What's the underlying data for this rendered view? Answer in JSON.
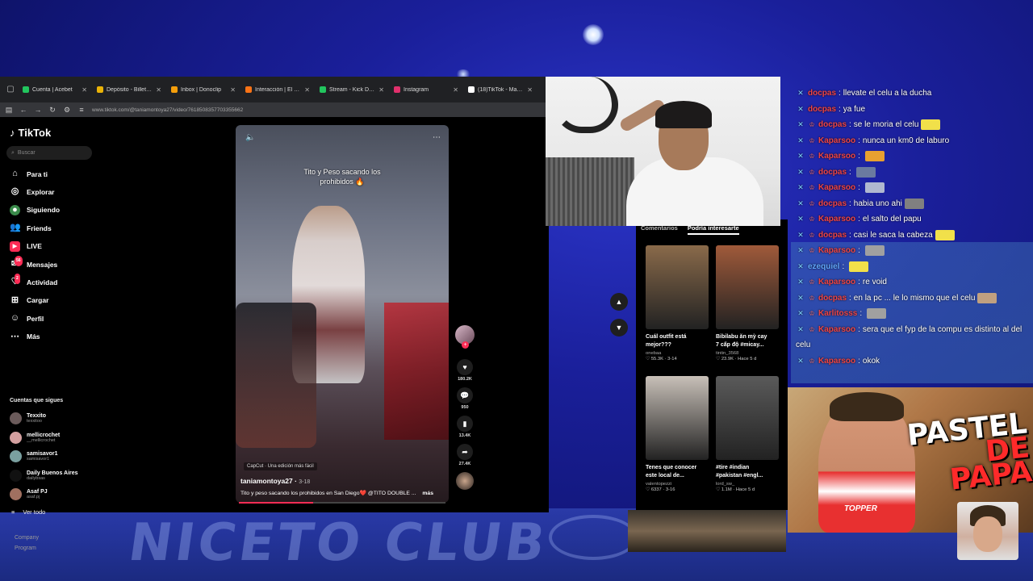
{
  "browser": {
    "tabs": [
      {
        "title": "Cuenta | Acebet",
        "color": "#22c55e"
      },
      {
        "title": "Depósito - Billeteras -",
        "color": "#eab308"
      },
      {
        "title": "Inbox | Donoclip",
        "color": "#f59e0b"
      },
      {
        "title": "Interacción | El mejor s",
        "color": "#f97316"
      },
      {
        "title": "Stream - Kick Dash",
        "color": "#22c55e"
      },
      {
        "title": "Instagram",
        "color": "#e1306c"
      },
      {
        "title": "(18)TikTok - Make You",
        "color": "#ffffff"
      }
    ],
    "url": "www.tiktok.com/@taniamontoya27/video/7618508357703355662"
  },
  "tiktok": {
    "logo": "TikTok",
    "search_placeholder": "Buscar",
    "nav": [
      {
        "label": "Para ti",
        "icon": "home-icon"
      },
      {
        "label": "Explorar",
        "icon": "compass-icon"
      },
      {
        "label": "Siguiendo",
        "icon": "following-icon"
      },
      {
        "label": "Friends",
        "icon": "friends-icon"
      },
      {
        "label": "LIVE",
        "icon": "live-icon"
      },
      {
        "label": "Mensajes",
        "icon": "messages-icon",
        "badge": "56"
      },
      {
        "label": "Actividad",
        "icon": "activity-icon",
        "badge": "2"
      },
      {
        "label": "Cargar",
        "icon": "upload-icon"
      },
      {
        "label": "Perfil",
        "icon": "profile-icon"
      },
      {
        "label": "Más",
        "icon": "more-icon"
      }
    ],
    "following_header": "Cuentas que sigues",
    "accounts": [
      {
        "name": "Texxito",
        "handle": "texxitoo",
        "color": "#6b5b5b"
      },
      {
        "name": "mellicrochet",
        "handle": "__mellicrochet",
        "color": "#d4a0a0"
      },
      {
        "name": "samisavor1",
        "handle": "samisavor1",
        "color": "#7aa0a0"
      },
      {
        "name": "Daily Buenos Aires",
        "handle": "dailybsas",
        "color": "#111111"
      },
      {
        "name": "Asaf PJ",
        "handle": "asaf.pj",
        "color": "#a07060"
      }
    ],
    "see_all": "Ver todo",
    "footer": [
      "Company",
      "Program"
    ]
  },
  "video": {
    "caption_line1": "Tito y Peso sacando los",
    "caption_line2": "prohibidos 🔥",
    "capcut": "CapCut · Una edición más fácil",
    "author": "taniamontoya27",
    "date": "3-18",
    "description": "Tito y peso sacando los prohibidos en San Diego❤️ @TITO DOUBLE ...",
    "more": "más",
    "progress": 0.36,
    "likes": "180.2K",
    "comments": "950",
    "saves": "13.4K",
    "shares": "27.4K"
  },
  "side_panel": {
    "tab_comments": "Comentarios",
    "tab_interesting": "Podría interesarte",
    "cards": [
      {
        "title1": "Cuál outfit está",
        "title2": "mejor???",
        "user": "onebaa",
        "meta": "55.3K · 3-14",
        "thumb": "#8a6a4a"
      },
      {
        "title1": "Bibilabu ăn mỳ cay",
        "title2": "7 cấp độ #micay...",
        "user": "tintin_3568",
        "meta": "23.9K · Hace 5 d",
        "thumb": "#a05a3a"
      },
      {
        "title1": "Tenes que conocer",
        "title2": "este local de...",
        "user": "valentopezzi",
        "meta": "6337 · 3-16",
        "thumb": "#c8c0b8"
      },
      {
        "title1": "#tire #indian",
        "title2": "#pakistan #engl...",
        "user": "lord_sw_",
        "meta": "1.1M · Hace 5 d",
        "thumb": "#5a5a5a"
      }
    ]
  },
  "chat": [
    {
      "user": "docpas",
      "text": "llevate el celu a la ducha",
      "ucolor": "#ef4444",
      "badge": "",
      "emote": ""
    },
    {
      "user": "docpas",
      "text": "ya fue",
      "ucolor": "#ef4444",
      "badge": "",
      "emote": ""
    },
    {
      "user": "docpas",
      "text": "se le moria el celu",
      "ucolor": "#ef4444",
      "badge": "sword",
      "emote": "#f1e04a"
    },
    {
      "user": "Kaparsoo",
      "text": "nunca un km0 de laburo",
      "ucolor": "#ef4444",
      "badge": "sword",
      "emote": ""
    },
    {
      "user": "Kaparsoo",
      "text": "",
      "ucolor": "#ef4444",
      "badge": "sword",
      "emote": "#e8a030"
    },
    {
      "user": "docpas",
      "text": "",
      "ucolor": "#ef4444",
      "badge": "sword",
      "emote": "#6a7aa0"
    },
    {
      "user": "Kaparsoo",
      "text": "",
      "ucolor": "#ef4444",
      "badge": "sword",
      "emote": "#b0b8d0"
    },
    {
      "user": "docpas",
      "text": "habia uno ahi",
      "ucolor": "#ef4444",
      "badge": "sword",
      "emote": "#808080"
    },
    {
      "user": "Kaparsoo",
      "text": "el salto del papu",
      "ucolor": "#ef4444",
      "badge": "sword",
      "emote": ""
    },
    {
      "user": "docpas",
      "text": "casi le saca la cabeza",
      "ucolor": "#ef4444",
      "badge": "sword",
      "emote": "#f1e04a"
    },
    {
      "user": "Kaparsoo",
      "text": "",
      "ucolor": "#ef4444",
      "badge": "sword",
      "emote": "#a0a0a0"
    },
    {
      "user": "ezequiel",
      "text": "",
      "ucolor": "#60a5fa",
      "badge": "",
      "emote": "#f1e04a"
    },
    {
      "user": "Kaparsoo",
      "text": "re void",
      "ucolor": "#ef4444",
      "badge": "sword",
      "emote": ""
    },
    {
      "user": "docpas",
      "text": "en la pc ... le lo mismo que el celu",
      "ucolor": "#ef4444",
      "badge": "sword",
      "emote": "#c0a080"
    },
    {
      "user": "Karlitosss",
      "text": "",
      "ucolor": "#ef4444",
      "badge": "sword",
      "emote": "#a0a0a0"
    },
    {
      "user": "Kaparsoo",
      "text": "sera que el fyp de la compu es distinto al del",
      "ucolor": "#ef4444",
      "badge": "sword",
      "emote": ""
    },
    {
      "user": "",
      "text": "celu",
      "ucolor": "#ffffff",
      "badge": "",
      "emote": ""
    },
    {
      "user": "Kaparsoo",
      "text": "okok",
      "ucolor": "#ef4444",
      "badge": "sword",
      "emote": ""
    }
  ],
  "promo": {
    "line1": "PASTEL",
    "line2": "DE PAPA",
    "shirt": "TOPPER"
  },
  "background": {
    "banner_text": "NICETO CLUB"
  }
}
